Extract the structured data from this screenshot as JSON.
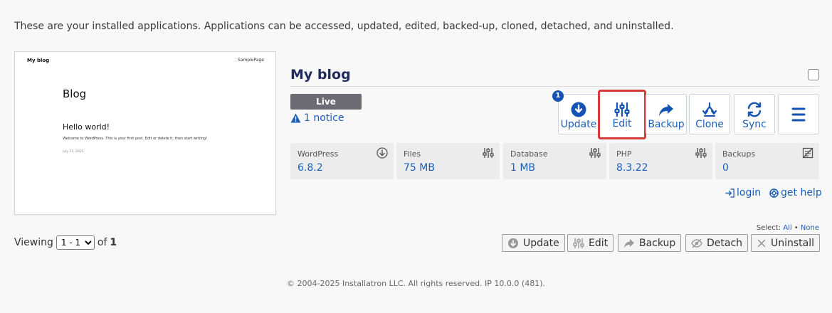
{
  "intro_text": "These are your installed applications. Applications can be accessed, updated, edited, backed-up, cloned, detached, and uninstalled.",
  "preview": {
    "site_name": "My blog",
    "nav_link": "SamplePage",
    "blog_title": "Blog",
    "post_title": "Hello world!",
    "post_excerpt": "Welcome to WordPress. This is your first post. Edit or delete it, then start writing!",
    "post_date": "July 15, 2025"
  },
  "app": {
    "title": "My blog",
    "status": "Live",
    "notice": "1 notice",
    "update_count": "1"
  },
  "actions": [
    {
      "label": "Update",
      "icon": "download-circle-icon"
    },
    {
      "label": "Edit",
      "icon": "sliders-icon"
    },
    {
      "label": "Backup",
      "icon": "share-arrow-icon"
    },
    {
      "label": "Clone",
      "icon": "fork-icon"
    },
    {
      "label": "Sync",
      "icon": "sync-icon"
    },
    {
      "label": "",
      "icon": "hamburger-menu-icon"
    }
  ],
  "tiles": [
    {
      "label": "WordPress",
      "value": "6.8.2",
      "icon": "download-circle-icon"
    },
    {
      "label": "Files",
      "value": "75 MB",
      "icon": "sliders-icon"
    },
    {
      "label": "Database",
      "value": "1 MB",
      "icon": "sliders-icon"
    },
    {
      "label": "PHP",
      "value": "8.3.22",
      "icon": "sliders-icon"
    },
    {
      "label": "Backups",
      "value": "0",
      "icon": "backup-list-icon"
    }
  ],
  "links": {
    "login": "login",
    "help": "get help"
  },
  "pagination": {
    "viewing_label": "Viewing",
    "range": "1 - 1",
    "of_label": "of",
    "total": "1"
  },
  "select": {
    "label": "Select:",
    "all": "All",
    "separator": "•",
    "none": "None"
  },
  "bulk_buttons": [
    {
      "label": "Update",
      "icon": "download-circle-icon"
    },
    {
      "label": "Edit",
      "icon": "sliders-icon"
    },
    {
      "label": "Backup",
      "icon": "share-arrow-icon"
    },
    {
      "label": "Detach",
      "icon": "eye-slash-icon"
    },
    {
      "label": "Uninstall",
      "icon": "close-icon"
    }
  ],
  "footer": "© 2004-2025 Installatron LLC. All rights reserved. IP 10.0.0 (481).",
  "colors": {
    "link": "#1c5fb8",
    "title": "#1f2a5a",
    "highlight": "#d83a3a",
    "live_badge": "#6b6b73"
  }
}
